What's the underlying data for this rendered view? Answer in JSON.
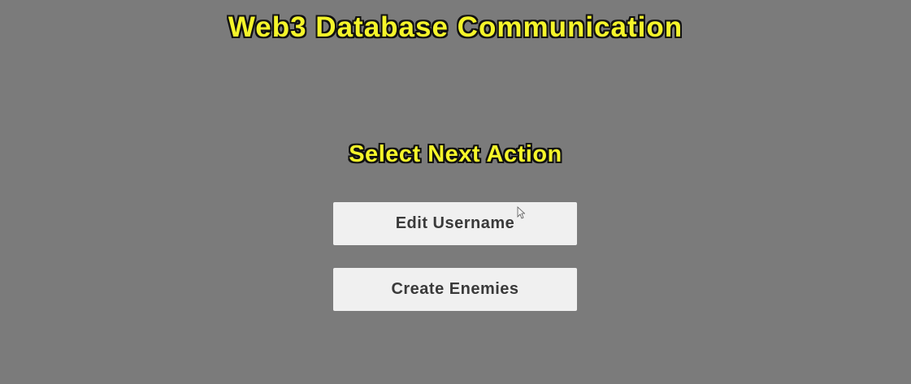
{
  "header": {
    "title": "Web3 Database Communication"
  },
  "menu": {
    "heading": "Select Next Action",
    "buttons": [
      {
        "label": "Edit Username"
      },
      {
        "label": "Create Enemies"
      }
    ]
  },
  "icons": {
    "cursor": "mouse-pointer-icon"
  },
  "colors": {
    "background": "#7b7b7b",
    "title_text": "#f5f52a",
    "title_outline": "#111111",
    "button_background": "#f0f0f0",
    "button_text": "#3a3a3a"
  }
}
